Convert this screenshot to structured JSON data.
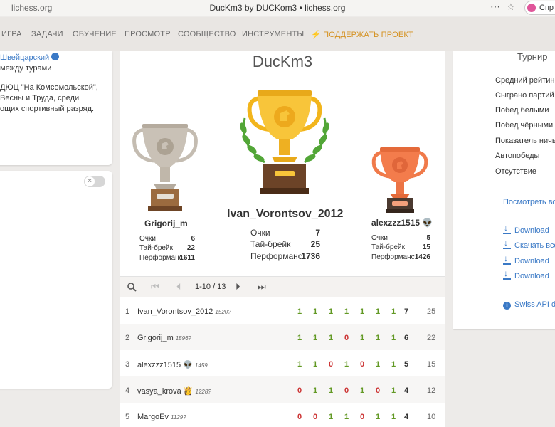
{
  "browser": {
    "url": "lichess.org",
    "title": "DucKm3 by DUCKom3 • lichess.org",
    "profile": "Спр"
  },
  "nav": {
    "items": [
      "ИГРА",
      "ЗАДАЧИ",
      "ОБУЧЕНИЕ",
      "ПРОСМОТР",
      "СООБЩЕСТВО",
      "ИНСТРУМЕНТЫ"
    ],
    "donate": "ПОДДЕРЖАТЬ ПРОЕКТ"
  },
  "left_panel": {
    "system": "Швейцарский",
    "lines": [
      "между турами",
      "ДЮЦ \"На Комсомольской\",",
      "Весны и Труда, среди",
      "ощих спортивный разряд."
    ]
  },
  "tournament": {
    "name": "DucKm3"
  },
  "podium": {
    "first": {
      "name": "Ivan_Vorontsov_2012",
      "points": "7",
      "tiebreak": "25",
      "performance": "1736"
    },
    "second": {
      "name": "Grigorij_m",
      "points": "6",
      "tiebreak": "22",
      "performance": "1611"
    },
    "third": {
      "name": "alexzzz1515",
      "points": "5",
      "tiebreak": "15",
      "performance": "1426"
    },
    "labels": {
      "points": "Очки",
      "tiebreak": "Тай-брейк",
      "performance": "Перформанс"
    }
  },
  "pager": {
    "range": "1-10 / 13"
  },
  "standings": [
    {
      "rank": "1",
      "name": "Ivan_Vorontsov_2012",
      "rating": "1520?",
      "badge": "",
      "scores": [
        "1",
        "1",
        "1",
        "1",
        "1",
        "1",
        "1"
      ],
      "points": "7",
      "tiebreak": "25"
    },
    {
      "rank": "2",
      "name": "Grigorij_m",
      "rating": "1596?",
      "badge": "",
      "scores": [
        "1",
        "1",
        "1",
        "0",
        "1",
        "1",
        "1"
      ],
      "points": "6",
      "tiebreak": "22"
    },
    {
      "rank": "3",
      "name": "alexzzz1515",
      "rating": "1459",
      "badge": "👽",
      "scores": [
        "1",
        "1",
        "0",
        "1",
        "0",
        "1",
        "1"
      ],
      "points": "5",
      "tiebreak": "15"
    },
    {
      "rank": "4",
      "name": "vasya_krova",
      "rating": "1228?",
      "badge": "👸",
      "scores": [
        "0",
        "1",
        "1",
        "0",
        "1",
        "0",
        "1"
      ],
      "points": "4",
      "tiebreak": "12"
    },
    {
      "rank": "5",
      "name": "MargoEv",
      "rating": "1129?",
      "badge": "",
      "scores": [
        "0",
        "0",
        "1",
        "1",
        "0",
        "1",
        "1"
      ],
      "points": "4",
      "tiebreak": "10"
    }
  ],
  "right_panel": {
    "heading": "Турнир",
    "stats": [
      "Средний рейтинг",
      "Сыграно партий",
      "Побед белыми",
      "Побед чёрными",
      "Показатель ничьих",
      "Автопобеды",
      "Отсутствие"
    ],
    "view_link": "Посмотреть все",
    "downloads": [
      "Download",
      "Скачать все",
      "Download",
      "Download"
    ],
    "api_link": "Swiss API do"
  },
  "colors": {
    "win": "#629924",
    "loss": "#cc3333",
    "link": "#3a79c6",
    "donate": "#d59120"
  }
}
